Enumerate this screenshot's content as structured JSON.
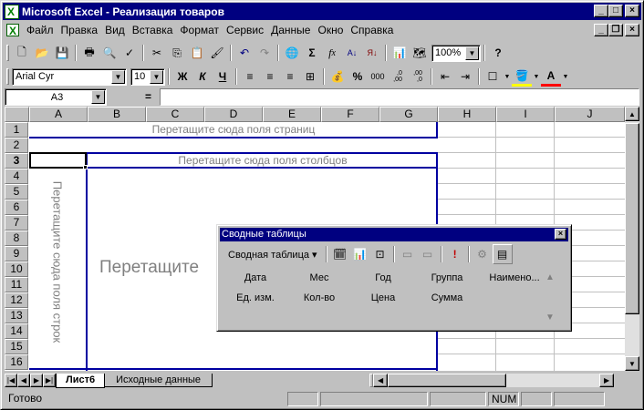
{
  "window": {
    "title": "Microsoft Excel - Реализация товаров"
  },
  "menu": [
    "Файл",
    "Правка",
    "Вид",
    "Вставка",
    "Формат",
    "Сервис",
    "Данные",
    "Окно",
    "Справка"
  ],
  "standard_toolbar": {
    "zoom": "100%"
  },
  "format_toolbar": {
    "font": "Arial Cyr",
    "size": "10",
    "bold": "Ж",
    "italic": "К",
    "underline": "Ч",
    "percent": "%",
    "thousands": "000",
    "inc_decimal": ",0\n,00",
    "dec_decimal": ",00\n,0"
  },
  "formula_bar": {
    "name_box": "A3",
    "equals": "="
  },
  "columns": [
    "A",
    "B",
    "C",
    "D",
    "E",
    "F",
    "G",
    "H",
    "I",
    "J"
  ],
  "rows": [
    "1",
    "2",
    "3",
    "4",
    "5",
    "6",
    "7",
    "8",
    "9",
    "10",
    "11",
    "12",
    "13",
    "14",
    "15",
    "16"
  ],
  "placeholders": {
    "page_fields": "Перетащите сюда поля страниц",
    "column_fields": "Перетащите сюда поля столбцов",
    "row_fields": "Перетащите сюда поля строк",
    "data_fields": "Перетащите"
  },
  "pivot_toolbar": {
    "title": "Сводные таблицы",
    "menu_label": "Сводная таблица",
    "fields": [
      "Дата",
      "Мес",
      "Год",
      "Группа",
      "Наимено...",
      "Ед. изм.",
      "Кол-во",
      "Цена",
      "Сумма"
    ]
  },
  "sheet_tabs": [
    "Лист6",
    "Исходные данные"
  ],
  "status": {
    "ready": "Готово",
    "num": "NUM"
  }
}
